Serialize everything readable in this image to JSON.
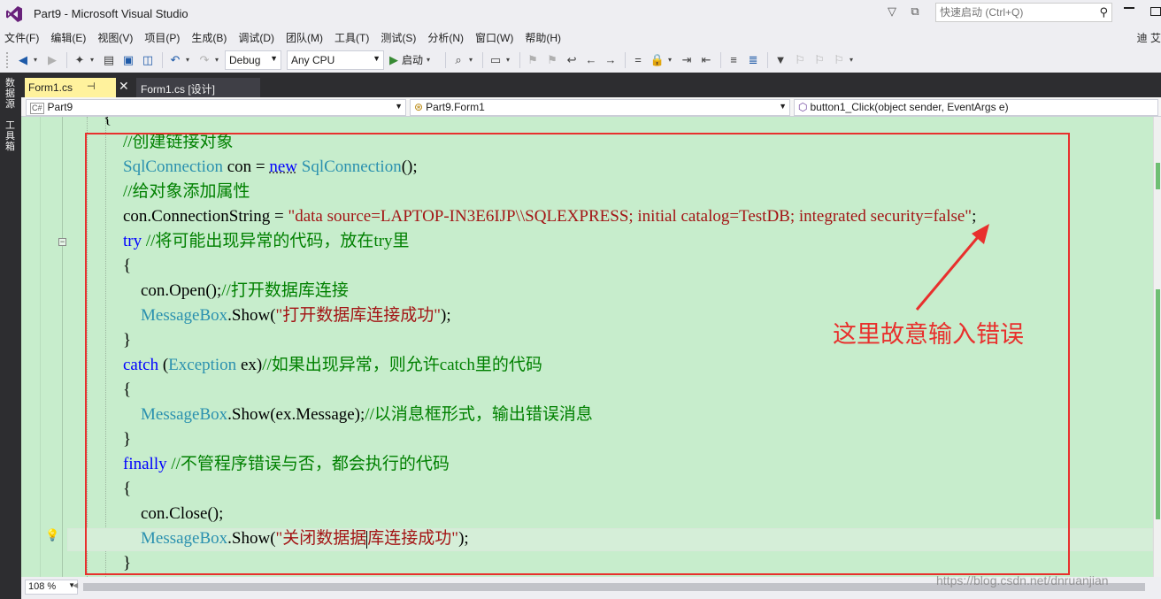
{
  "window": {
    "title": "Part9 - Microsoft Visual Studio",
    "quick_launch_placeholder": "快速启动 (Ctrl+Q)",
    "user_initials": "迪 艾"
  },
  "menu": [
    "文件(F)",
    "编辑(E)",
    "视图(V)",
    "项目(P)",
    "生成(B)",
    "调试(D)",
    "团队(M)",
    "工具(T)",
    "测试(S)",
    "分析(N)",
    "窗口(W)",
    "帮助(H)"
  ],
  "toolbar": {
    "config": "Debug",
    "platform": "Any CPU",
    "start_label": "启动"
  },
  "left_strip": {
    "item1": "数据源",
    "item2": "工具箱"
  },
  "tabs": {
    "active": "Form1.cs",
    "inactive": "Form1.cs [设计]"
  },
  "navbar": {
    "project": "Part9",
    "class": "Part9.Form1",
    "member": "button1_Click(object sender, EventArgs e)",
    "project_icon": "C#"
  },
  "code": {
    "brace_top": "{",
    "l1_comment": "//创建链接对象",
    "l2_type1": "SqlConnection",
    "l2_mid": " con = ",
    "l2_new": "new",
    "l2_type2": "SqlConnection",
    "l2_end": "();",
    "l3_comment": "//给对象添加属性",
    "l4_pre": "con.ConnectionString = ",
    "l4_str": "\"data source=LAPTOP-IN3E6IJP\\\\SQLEXPRESS; initial catalog=TestDB; integrated security=false\"",
    "l4_end": ";",
    "l5_kw": "try",
    "l5_comment": " //将可能出现异常的代码，放在try里",
    "open_brace": "{",
    "close_brace": "}",
    "l7_code": "con.Open();",
    "l7_comment": "//打开数据库连接",
    "l8_type": "MessageBox",
    "l8_mid": ".Show(",
    "l8_str": "\"打开数据库连接成功\"",
    "l8_end": ");",
    "l10_kw": "catch",
    "l10_p1": " (",
    "l10_type": "Exception",
    "l10_p2": " ex)",
    "l10_comment": "//如果出现异常，则允许catch里的代码",
    "l12_type": "MessageBox",
    "l12_mid": ".Show(ex.Message);",
    "l12_comment": "//以消息框形式，输出错误消息",
    "l14_kw": "finally",
    "l14_comment": " //不管程序错误与否，都会执行的代码",
    "l16_code": "con.Close();",
    "l17_type": "MessageBox",
    "l17_mid": ".Show(",
    "l17_str_a": "\"关闭数据据",
    "l17_str_b": "库连接成功\"",
    "l17_end": ");"
  },
  "annotation": {
    "text": "这里故意输入错误",
    "color": "#e8302d"
  },
  "statusbar": {
    "zoom": "108 %"
  },
  "watermark": "https://blog.csdn.net/dnruanjian"
}
